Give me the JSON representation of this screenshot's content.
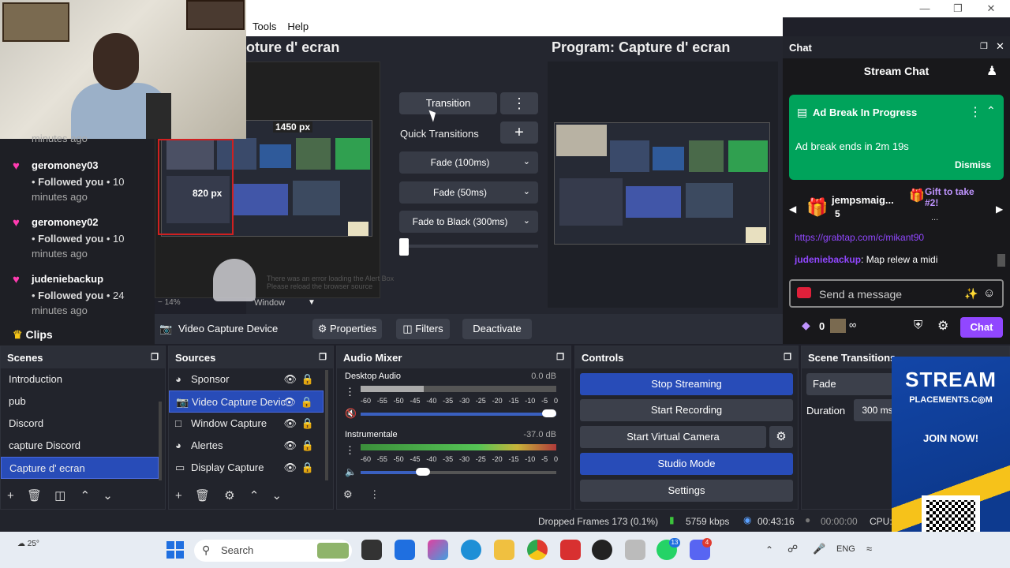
{
  "menu": {
    "tools": "Tools",
    "help": "Help"
  },
  "preview": {
    "title": "oture d' ecran",
    "dim1": "1450 px",
    "dim2": "820 px",
    "error_line1": "There was an error loading the Alert Box",
    "error_line2": "Please reload the browser source",
    "zoom": "14%",
    "window_label": "Window"
  },
  "program": {
    "title": "Program: Capture d' ecran"
  },
  "transition_panel": {
    "transition": "Transition",
    "quick_transitions": "Quick Transitions",
    "items": [
      "Fade (100ms)",
      "Fade (50ms)",
      "Fade to Black (300ms)"
    ]
  },
  "source_toolbar": {
    "source": "Video Capture Device",
    "properties": "Properties",
    "filters": "Filters",
    "deactivate": "Deactivate"
  },
  "feed": [
    {
      "name": "",
      "line1": "minutes ago",
      "line2": ""
    },
    {
      "name": "geromoney03",
      "line1": "Followed you",
      "line1b": "• 10",
      "line2": "minutes ago"
    },
    {
      "name": "geromoney02",
      "line1": "Followed you",
      "line1b": "• 10",
      "line2": "minutes ago"
    },
    {
      "name": "judeniebackup",
      "line1": "Followed you",
      "line1b": "• 24",
      "line2": "minutes ago"
    }
  ],
  "clips": "Clips",
  "chat": {
    "panel_title": "Chat",
    "stream_chat": "Stream Chat",
    "ad_title": "Ad Break In Progress",
    "ad_text": "Ad break ends in 2m 19s",
    "dismiss": "Dismiss",
    "gift_user": "jempsmaig...",
    "gift_count": "5",
    "gift_text": "Gift to take #2!",
    "gift_sub": "...",
    "url_line": "https://grabtap.com/c/mikant90",
    "msg_user": "judeniebackup",
    "msg_text": "Map relew a midi",
    "send_placeholder": "Send a message",
    "bits": "0",
    "infinity": "∞",
    "chat_button": "Chat"
  },
  "scenes": {
    "title": "Scenes",
    "items": [
      "Introduction",
      "pub",
      "Discord",
      "capture Discord",
      "Capture d' ecran"
    ],
    "selected": "Capture d' ecran"
  },
  "sources": {
    "title": "Sources",
    "items": [
      "Sponsor",
      "Video Capture Devic",
      "Window Capture",
      "Alertes",
      "Display Capture"
    ],
    "selected": "Video Capture Devic"
  },
  "audio": {
    "title": "Audio Mixer",
    "channels": [
      {
        "name": "Desktop Audio",
        "db": "0.0 dB"
      },
      {
        "name": "Instrumentale",
        "db": "-37.0 dB"
      }
    ],
    "scale": [
      "-60",
      "-55",
      "-50",
      "-45",
      "-40",
      "-35",
      "-30",
      "-25",
      "-20",
      "-15",
      "-10",
      "-5",
      "0"
    ]
  },
  "controls": {
    "title": "Controls",
    "stop_streaming": "Stop Streaming",
    "start_recording": "Start Recording",
    "start_virtual_camera": "Start Virtual Camera",
    "studio_mode": "Studio Mode",
    "settings": "Settings"
  },
  "scene_transitions": {
    "title": "Scene Transitions",
    "value": "Fade",
    "duration_label": "Duration",
    "duration_value": "300 ms"
  },
  "status": {
    "dropped": "Dropped Frames 173 (0.1%)",
    "kbps": "5759 kbps",
    "stream_time": "00:43:16",
    "rec_time": "00:00:00",
    "cpu": "CPU:"
  },
  "ad_banner": {
    "line1": "STREAM",
    "line2": "PLACEMENTS.C◎M",
    "cta": "JOIN NOW!"
  },
  "taskbar": {
    "weather": "25°",
    "search": "Search",
    "lang": "ENG",
    "badge1": "13",
    "badge2": "4"
  },
  "colors": {
    "accent_blue": "#284cb8",
    "twitch_purple": "#9147ff",
    "ad_green": "#00a35b"
  }
}
